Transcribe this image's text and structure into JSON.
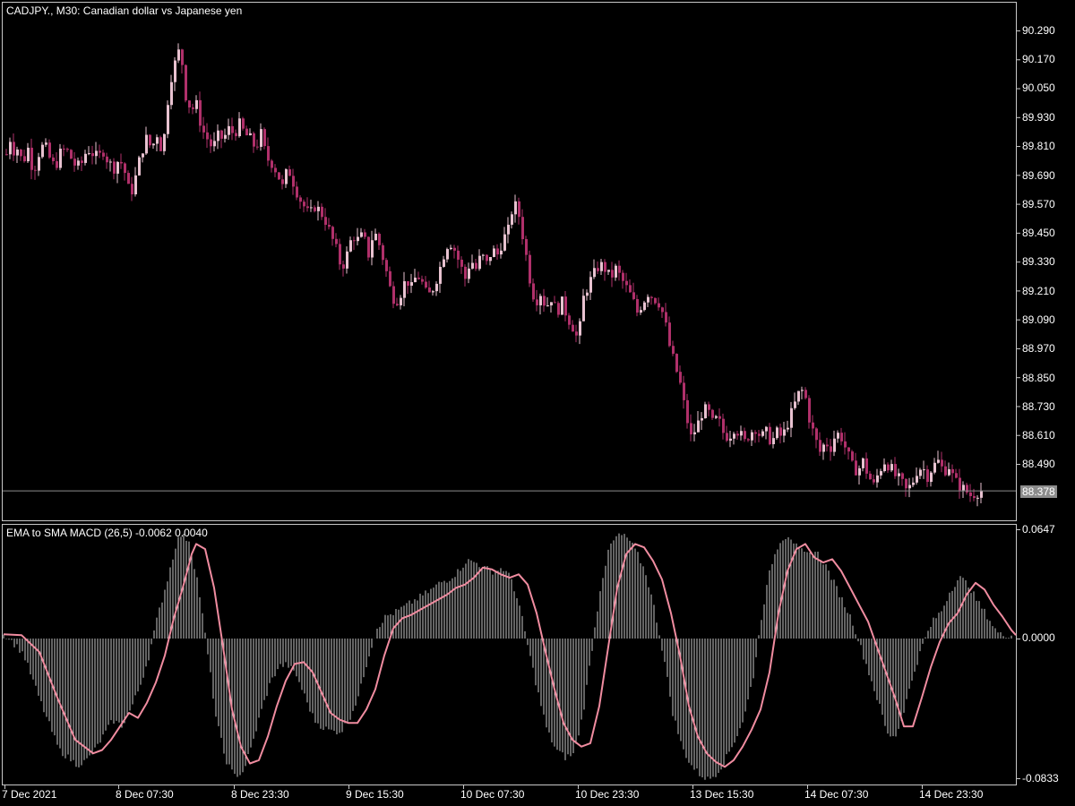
{
  "main_chart": {
    "title": "CADJPY., M30:  Canadian dollar vs Japanese yen",
    "bid_label": "88.378",
    "bid_value": 88.378,
    "price_ticks": [
      "90.290",
      "90.170",
      "90.050",
      "89.930",
      "89.810",
      "89.690",
      "89.570",
      "89.450",
      "89.330",
      "89.210",
      "89.090",
      "88.970",
      "88.850",
      "88.730",
      "88.610",
      "88.490"
    ],
    "colors": {
      "candle_down": "#b0306a",
      "candle_up": "#e8c2d0",
      "doji": "#2ecc40",
      "bid_line": "#8c8c8c"
    }
  },
  "indicator": {
    "title": "EMA to SMA MACD (26,5) -0.0062 0.0040",
    "ticks": [
      "0.0647",
      "0.0000",
      "-0.0833"
    ],
    "colors": {
      "histogram": "#c8c8c8",
      "signal": "#f08ca0"
    }
  },
  "time_axis": {
    "labels": [
      "7 Dec 2021",
      "8 Dec 07:30",
      "8 Dec 23:30",
      "9 Dec 15:30",
      "10 Dec 07:30",
      "10 Dec 23:30",
      "13 Dec 15:30",
      "14 Dec 07:30",
      "14 Dec 23:30"
    ]
  },
  "chart_data": [
    {
      "type": "candlestick",
      "title": "CADJPY., M30:  Canadian dollar vs Japanese yen",
      "ylim": [
        88.37,
        90.35
      ],
      "path_x": [
        0,
        5,
        10,
        15,
        18,
        24,
        30,
        36,
        42,
        48,
        54,
        60,
        66,
        72,
        78,
        84,
        90,
        96,
        102,
        108,
        114,
        120,
        126,
        132,
        138,
        144,
        150,
        156,
        162,
        168,
        174,
        180,
        186,
        190,
        196,
        200,
        206,
        212,
        218,
        224,
        230,
        236,
        242,
        248,
        254,
        260,
        266,
        272,
        278,
        284,
        290,
        296,
        302,
        308,
        314,
        320,
        326,
        332,
        338,
        344,
        350,
        356,
        362,
        368,
        374,
        380,
        386,
        392,
        398,
        404,
        410,
        416,
        422,
        428,
        434,
        440,
        446,
        452,
        458,
        464,
        470,
        476,
        482,
        488,
        494,
        500,
        506,
        512,
        518,
        524,
        530,
        536,
        542,
        548,
        554,
        560,
        566,
        572,
        578,
        584,
        590,
        596,
        602,
        608,
        614,
        620,
        626,
        632,
        638,
        644,
        650,
        656,
        662,
        668,
        674,
        680,
        686,
        692,
        698,
        704,
        710,
        716,
        722,
        728,
        734,
        740,
        746,
        752,
        758,
        764,
        770,
        776,
        782,
        788,
        794,
        800,
        806,
        812,
        818,
        824,
        830,
        836,
        842,
        848,
        854,
        860,
        866,
        872,
        878,
        884,
        890,
        896,
        902,
        908,
        914,
        920,
        926,
        932,
        938,
        944,
        950,
        956,
        962,
        968,
        974,
        980,
        986,
        992,
        998,
        1004,
        1010,
        1016,
        1022,
        1028,
        1034,
        1040,
        1046,
        1052,
        1058,
        1064,
        1070,
        1076,
        1082,
        1088,
        1094,
        1100,
        1106,
        1112,
        1118,
        1124
      ],
      "path_close": [
        89.72,
        89.76,
        89.84,
        89.78,
        89.8,
        89.74,
        89.8,
        89.7,
        89.78,
        89.82,
        89.76,
        89.72,
        89.78,
        89.8,
        89.76,
        89.72,
        89.74,
        89.8,
        89.78,
        89.76,
        89.79,
        89.74,
        89.72,
        89.76,
        89.7,
        89.6,
        89.68,
        89.78,
        89.84,
        89.8,
        89.86,
        89.78,
        90.0,
        90.1,
        90.18,
        90.22,
        90.02,
        89.96,
        89.98,
        89.88,
        89.84,
        89.8,
        89.85,
        89.84,
        89.88,
        89.86,
        89.9,
        89.86,
        89.84,
        89.8,
        89.86,
        89.76,
        89.74,
        89.7,
        89.64,
        89.72,
        89.66,
        89.6,
        89.56,
        89.52,
        89.56,
        89.54,
        89.5,
        89.44,
        89.38,
        89.3,
        89.36,
        89.44,
        89.42,
        89.44,
        89.36,
        89.46,
        89.4,
        89.32,
        89.22,
        89.16,
        89.2,
        89.26,
        89.22,
        89.28,
        89.24,
        89.18,
        89.22,
        89.28,
        89.36,
        89.42,
        89.38,
        89.32,
        89.26,
        89.34,
        89.3,
        89.36,
        89.32,
        89.38,
        89.36,
        89.42,
        89.46,
        89.58,
        89.52,
        89.4,
        89.26,
        89.16,
        89.2,
        89.14,
        89.18,
        89.12,
        89.16,
        89.1,
        89.06,
        89.0,
        89.18,
        89.24,
        89.28,
        89.32,
        89.3,
        89.26,
        89.3,
        89.26,
        89.22,
        89.18,
        89.12,
        89.16,
        89.2,
        89.18,
        89.16,
        89.1,
        88.98,
        88.9,
        88.82,
        88.7,
        88.6,
        88.64,
        88.7,
        88.72,
        88.66,
        88.68,
        88.62,
        88.6,
        88.64,
        88.62,
        88.58,
        88.62,
        88.64,
        88.6,
        88.62,
        88.58,
        88.62,
        88.6,
        88.66,
        88.72,
        88.78,
        88.8,
        88.68,
        88.6,
        88.54,
        88.58,
        88.56,
        88.62,
        88.6,
        88.54,
        88.48,
        88.46,
        88.5,
        88.44,
        88.4,
        88.46,
        88.5,
        88.48,
        88.44,
        88.42,
        88.38,
        88.4,
        88.46,
        88.48,
        88.44,
        88.48,
        88.5,
        88.46,
        88.48,
        88.42,
        88.4,
        88.38,
        88.36,
        88.37,
        88.38
      ]
    },
    {
      "type": "bar+line",
      "title": "EMA to SMA MACD (26,5) -0.0062 0.0040",
      "ylim": [
        -0.0833,
        0.0647
      ],
      "signal_x": [
        0,
        20,
        40,
        60,
        80,
        100,
        110,
        120,
        130,
        140,
        150,
        160,
        170,
        180,
        190,
        200,
        210,
        215,
        225,
        235,
        245,
        255,
        265,
        275,
        285,
        295,
        305,
        315,
        325,
        335,
        345,
        355,
        365,
        375,
        385,
        395,
        405,
        415,
        425,
        435,
        445,
        455,
        465,
        475,
        485,
        495,
        505,
        515,
        525,
        535,
        545,
        555,
        565,
        575,
        585,
        595,
        605,
        615,
        625,
        635,
        645,
        655,
        665,
        675,
        685,
        695,
        705,
        715,
        725,
        735,
        745,
        755,
        765,
        775,
        785,
        795,
        805,
        815,
        825,
        835,
        845,
        855,
        865,
        875,
        885,
        895,
        905,
        915,
        925,
        935,
        945,
        955,
        965,
        975,
        985,
        995,
        1005,
        1015,
        1025,
        1035,
        1045,
        1055,
        1065,
        1075,
        1085,
        1095,
        1105,
        1115,
        1125,
        1130
      ],
      "signal_y": [
        0.0025,
        0.002,
        -0.008,
        -0.035,
        -0.06,
        -0.068,
        -0.066,
        -0.06,
        -0.052,
        -0.044,
        -0.047,
        -0.038,
        -0.026,
        -0.01,
        0.012,
        0.03,
        0.05,
        0.056,
        0.053,
        0.03,
        -0.005,
        -0.042,
        -0.064,
        -0.074,
        -0.072,
        -0.058,
        -0.04,
        -0.025,
        -0.015,
        -0.014,
        -0.02,
        -0.032,
        -0.044,
        -0.048,
        -0.05,
        -0.05,
        -0.042,
        -0.03,
        -0.01,
        0.006,
        0.012,
        0.014,
        0.017,
        0.02,
        0.023,
        0.026,
        0.03,
        0.032,
        0.036,
        0.042,
        0.041,
        0.038,
        0.036,
        0.038,
        0.032,
        0.015,
        -0.008,
        -0.03,
        -0.05,
        -0.06,
        -0.064,
        -0.062,
        -0.04,
        -0.005,
        0.03,
        0.05,
        0.056,
        0.054,
        0.046,
        0.035,
        0.015,
        -0.01,
        -0.04,
        -0.058,
        -0.068,
        -0.073,
        -0.076,
        -0.072,
        -0.064,
        -0.054,
        -0.042,
        -0.02,
        0.015,
        0.04,
        0.053,
        0.056,
        0.048,
        0.045,
        0.047,
        0.04,
        0.03,
        0.02,
        0.01,
        -0.005,
        -0.02,
        -0.035,
        -0.052,
        -0.052,
        -0.035,
        -0.017,
        -0.002,
        0.009,
        0.015,
        0.026,
        0.033,
        0.029,
        0.02,
        0.013,
        0.005,
        0.002
      ]
    }
  ]
}
